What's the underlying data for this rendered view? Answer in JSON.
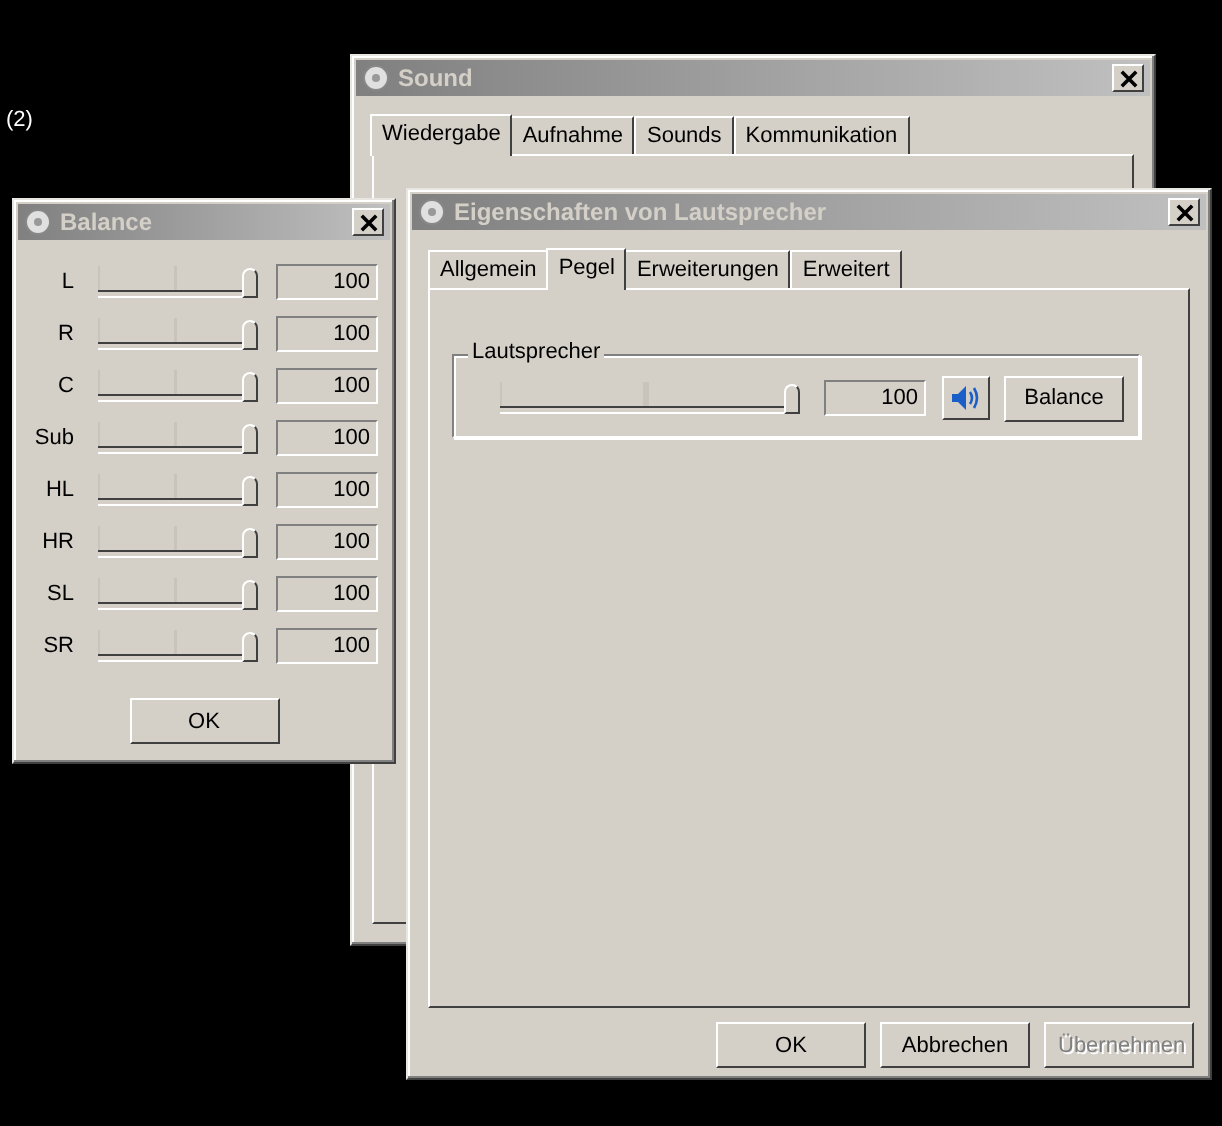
{
  "note": "(2)",
  "sound_window": {
    "title": "Sound",
    "tabs": [
      {
        "label": "Wiedergabe",
        "selected": true
      },
      {
        "label": "Aufnahme",
        "selected": false
      },
      {
        "label": "Sounds",
        "selected": false
      },
      {
        "label": "Kommunikation",
        "selected": false
      }
    ]
  },
  "balance_window": {
    "title": "Balance",
    "channels": [
      {
        "name": "L",
        "level": 1,
        "reading": "100"
      },
      {
        "name": "R",
        "level": 1,
        "reading": "100"
      },
      {
        "name": "C",
        "level": 1,
        "reading": "100"
      },
      {
        "name": "Sub",
        "level": 1,
        "reading": "100"
      },
      {
        "name": "HL",
        "level": 1,
        "reading": "100"
      },
      {
        "name": "HR",
        "level": 1,
        "reading": "100"
      },
      {
        "name": "SL",
        "level": 1,
        "reading": "100"
      },
      {
        "name": "SR",
        "level": 1,
        "reading": "100"
      }
    ],
    "ok_button": "OK"
  },
  "properties_window": {
    "title": "Eigenschaften von Lautsprecher",
    "tabs": [
      {
        "label": "Allgemein",
        "selected": false
      },
      {
        "label": "Pegel",
        "selected": true
      },
      {
        "label": "Erweiterungen",
        "selected": false
      },
      {
        "label": "Erweitert",
        "selected": false
      }
    ],
    "group": {
      "label": "Lautsprecher",
      "level": 1,
      "reading": "100",
      "muted": false,
      "balance_button": "Balance"
    },
    "buttons": [
      {
        "label": "OK",
        "disabled": false
      },
      {
        "label": "Abbrechen",
        "disabled": false
      },
      {
        "label": "Übernehmen",
        "disabled": true
      }
    ]
  }
}
